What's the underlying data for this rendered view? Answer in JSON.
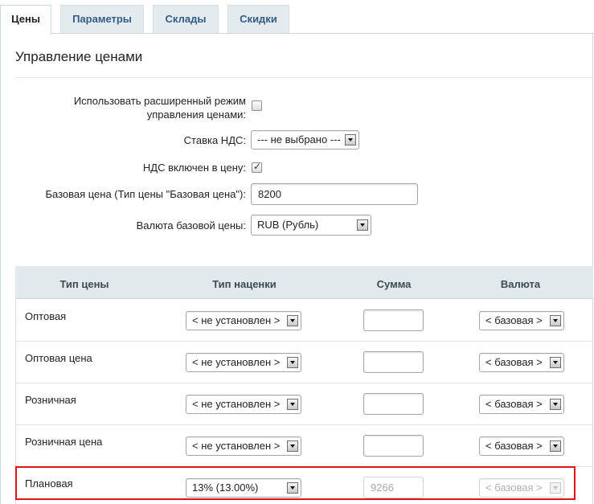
{
  "tabs": [
    {
      "label": "Цены",
      "active": true
    },
    {
      "label": "Параметры",
      "active": false
    },
    {
      "label": "Склады",
      "active": false
    },
    {
      "label": "Скидки",
      "active": false
    }
  ],
  "section": {
    "title": "Управление ценами"
  },
  "form": {
    "advanced_mode": {
      "label_line1": "Использовать расширенный режим",
      "label_line2": "управления ценами:",
      "checked": false
    },
    "vat_rate": {
      "label": "Ставка НДС:",
      "value": "--- не выбрано ---"
    },
    "vat_included": {
      "label": "НДС включен в цену:",
      "checked": true
    },
    "base_price": {
      "label": "Базовая цена (Тип цены \"Базовая цена\"):",
      "value": "8200"
    },
    "base_currency": {
      "label": "Валюта базовой цены:",
      "value": "RUB (Рубль)"
    }
  },
  "table": {
    "headers": {
      "price_type": "Тип цены",
      "markup_type": "Тип наценки",
      "sum": "Сумма",
      "currency": "Валюта"
    },
    "rows": [
      {
        "name": "Оптовая",
        "markup": "< не установлен >",
        "sum": "",
        "currency": "< базовая >",
        "disabled": false
      },
      {
        "name": "Оптовая цена",
        "markup": "< не установлен >",
        "sum": "",
        "currency": "< базовая >",
        "disabled": false
      },
      {
        "name": "Розничная",
        "markup": "< не установлен >",
        "sum": "",
        "currency": "< базовая >",
        "disabled": false
      },
      {
        "name": "Розничная цена",
        "markup": "< не установлен >",
        "sum": "",
        "currency": "< базовая >",
        "disabled": false
      },
      {
        "name": "Плановая",
        "markup": "13% (13.00%)",
        "sum": "9266",
        "currency": "< базовая >",
        "disabled": true
      }
    ]
  },
  "colors": {
    "highlight": "#e0121a",
    "tab_text": "#335c87",
    "header_bg": "#e2e9ec"
  }
}
